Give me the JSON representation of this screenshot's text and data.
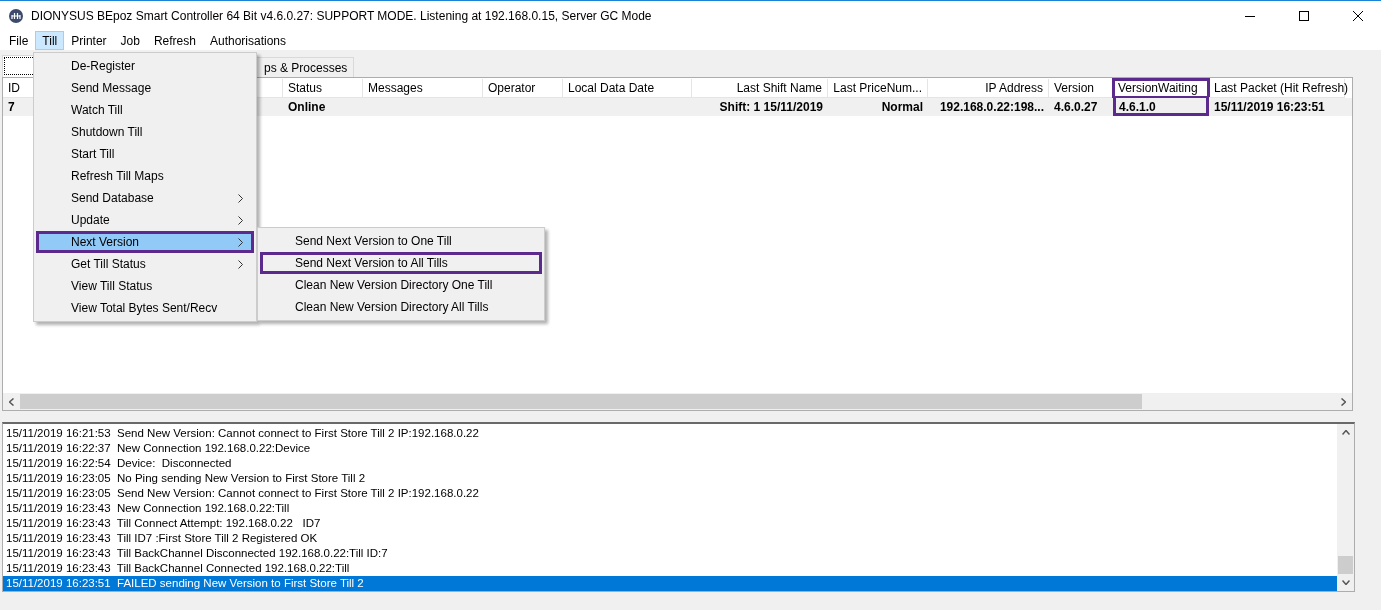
{
  "window": {
    "title": "DIONYSUS BEpoz Smart Controller 64 Bit v4.6.0.27: SUPPORT MODE. Listening at 192.168.0.15,  Server GC Mode"
  },
  "menu_bar": [
    {
      "label": "File",
      "selected": false
    },
    {
      "label": "Till",
      "selected": true
    },
    {
      "label": "Printer",
      "selected": false
    },
    {
      "label": "Job",
      "selected": false
    },
    {
      "label": "Refresh",
      "selected": false
    },
    {
      "label": "Authorisations",
      "selected": false
    }
  ],
  "tabs": [
    {
      "selected": true
    },
    {
      "label": "ps & Processes",
      "selected": false
    }
  ],
  "table": {
    "columns": [
      {
        "label": "ID",
        "highlighted": false
      },
      {
        "highlighted": false
      },
      {
        "label": "Status",
        "highlighted": false
      },
      {
        "label": "Messages",
        "highlighted": false
      },
      {
        "label": "Operator",
        "highlighted": false
      },
      {
        "label": "Local Data Date",
        "highlighted": false
      },
      {
        "label": "Last Shift Name",
        "highlighted": false
      },
      {
        "label": "Last PriceNum...",
        "highlighted": false
      },
      {
        "label": "IP Address",
        "highlighted": false
      },
      {
        "label": "Version",
        "highlighted": false
      },
      {
        "label": "VersionWaiting",
        "highlighted": true
      },
      {
        "label": "Last Packet (Hit Refresh)",
        "highlighted": false
      }
    ],
    "rows": [
      {
        "cells": [
          "7",
          "",
          "Online",
          "",
          "",
          "",
          "Shift: 1 15/11/2019",
          "Normal",
          "192.168.0.22:198...",
          "4.6.0.27",
          "4.6.1.0",
          "15/11/2019 16:23:51"
        ]
      }
    ]
  },
  "till_menu": [
    {
      "label": "De-Register",
      "submenu": false,
      "selected": false,
      "highlighted": false
    },
    {
      "label": "Send Message",
      "submenu": false,
      "selected": false,
      "highlighted": false
    },
    {
      "label": "Watch Till",
      "submenu": false,
      "selected": false,
      "highlighted": false
    },
    {
      "label": "Shutdown Till",
      "submenu": false,
      "selected": false,
      "highlighted": false
    },
    {
      "label": "Start Till",
      "submenu": false,
      "selected": false,
      "highlighted": false
    },
    {
      "label": "Refresh Till Maps",
      "submenu": false,
      "selected": false,
      "highlighted": false
    },
    {
      "label": "Send Database",
      "submenu": true,
      "selected": false,
      "highlighted": false
    },
    {
      "label": "Update",
      "submenu": true,
      "selected": false,
      "highlighted": false
    },
    {
      "label": "Next Version",
      "submenu": true,
      "selected": true,
      "highlighted": true
    },
    {
      "label": "Get Till Status",
      "submenu": true,
      "selected": false,
      "highlighted": false
    },
    {
      "label": "View Till Status",
      "submenu": false,
      "selected": false,
      "highlighted": false
    },
    {
      "label": "View Total Bytes Sent/Recv",
      "submenu": false,
      "selected": false,
      "highlighted": false
    }
  ],
  "next_version_submenu": [
    {
      "label": "Send Next Version to One Till",
      "highlighted": false
    },
    {
      "label": "Send Next Version to All Tills",
      "highlighted": true
    },
    {
      "label": "Clean New Version Directory One Till",
      "highlighted": false
    },
    {
      "label": "Clean New Version Directory All Tills",
      "highlighted": false
    }
  ],
  "log": [
    {
      "text": "15/11/2019 16:21:53  Send New Version: Cannot connect to First Store Till 2 IP:192.168.0.22",
      "selected": false
    },
    {
      "text": "15/11/2019 16:22:37  New Connection 192.168.0.22:Device",
      "selected": false
    },
    {
      "text": "15/11/2019 16:22:54  Device:  Disconnected",
      "selected": false
    },
    {
      "text": "15/11/2019 16:23:05  No Ping sending New Version to First Store Till 2",
      "selected": false
    },
    {
      "text": "15/11/2019 16:23:05  Send New Version: Cannot connect to First Store Till 2 IP:192.168.0.22",
      "selected": false
    },
    {
      "text": "15/11/2019 16:23:43  New Connection 192.168.0.22:Till",
      "selected": false
    },
    {
      "text": "15/11/2019 16:23:43  Till Connect Attempt: 192.168.0.22   ID7",
      "selected": false
    },
    {
      "text": "15/11/2019 16:23:43  Till ID7 :First Store Till 2 Registered OK",
      "selected": false
    },
    {
      "text": "15/11/2019 16:23:43  Till BackChannel Disconnected 192.168.0.22:Till ID:7",
      "selected": false
    },
    {
      "text": "15/11/2019 16:23:43  Till BackChannel Connected 192.168.0.22:Till",
      "selected": false
    },
    {
      "text": "15/11/2019 16:23:51  FAILED sending New Version to First Store Till 2",
      "selected": true
    }
  ]
}
